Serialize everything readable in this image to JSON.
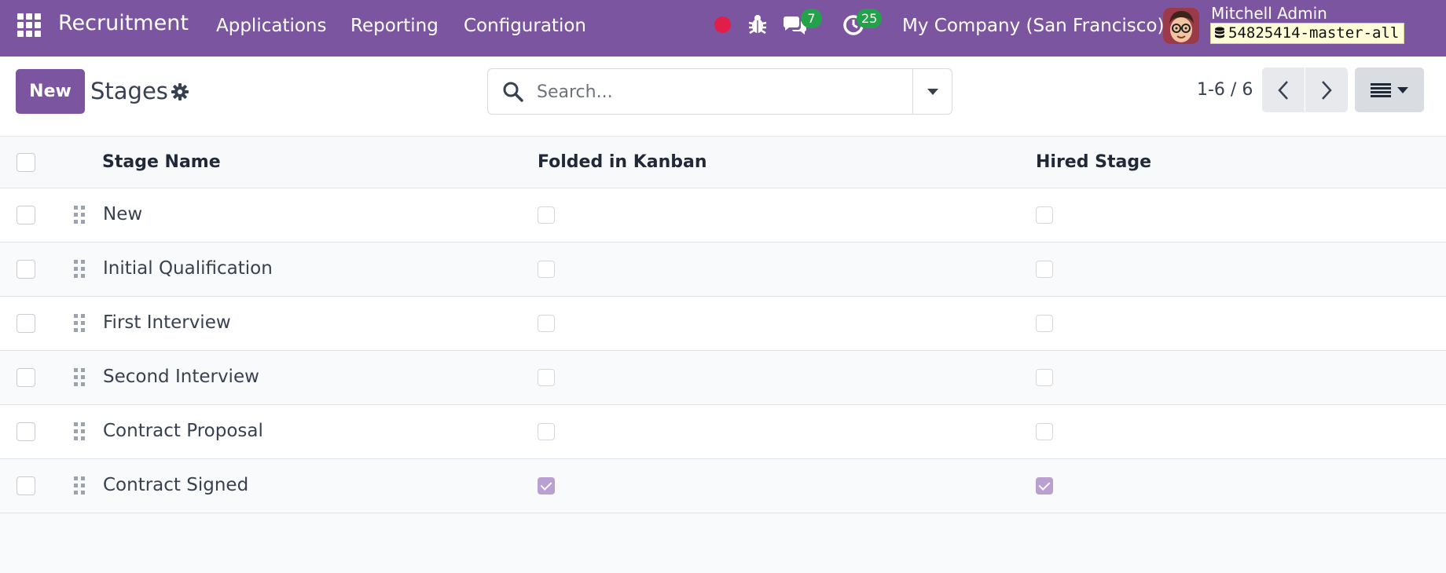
{
  "navbar": {
    "brand": "Recruitment",
    "menu": [
      {
        "label": "Applications"
      },
      {
        "label": "Reporting"
      },
      {
        "label": "Configuration"
      }
    ],
    "messages_count": "7",
    "activities_count": "25",
    "company": "My Company (San Francisco)",
    "user_name": "Mitchell Admin",
    "database": "54825414-master-all",
    "accent_color": "#7c55a1",
    "badge_color": "#22a34a"
  },
  "control": {
    "new_label": "New",
    "title": "Stages",
    "search_placeholder": "Search...",
    "pager": "1-6 / 6"
  },
  "table": {
    "columns": [
      "Stage Name",
      "Folded in Kanban",
      "Hired Stage"
    ],
    "rows": [
      {
        "name": "New",
        "folded": false,
        "hired": false
      },
      {
        "name": "Initial Qualification",
        "folded": false,
        "hired": false
      },
      {
        "name": "First Interview",
        "folded": false,
        "hired": false
      },
      {
        "name": "Second Interview",
        "folded": false,
        "hired": false
      },
      {
        "name": "Contract Proposal",
        "folded": false,
        "hired": false
      },
      {
        "name": "Contract Signed",
        "folded": true,
        "hired": true
      }
    ]
  }
}
